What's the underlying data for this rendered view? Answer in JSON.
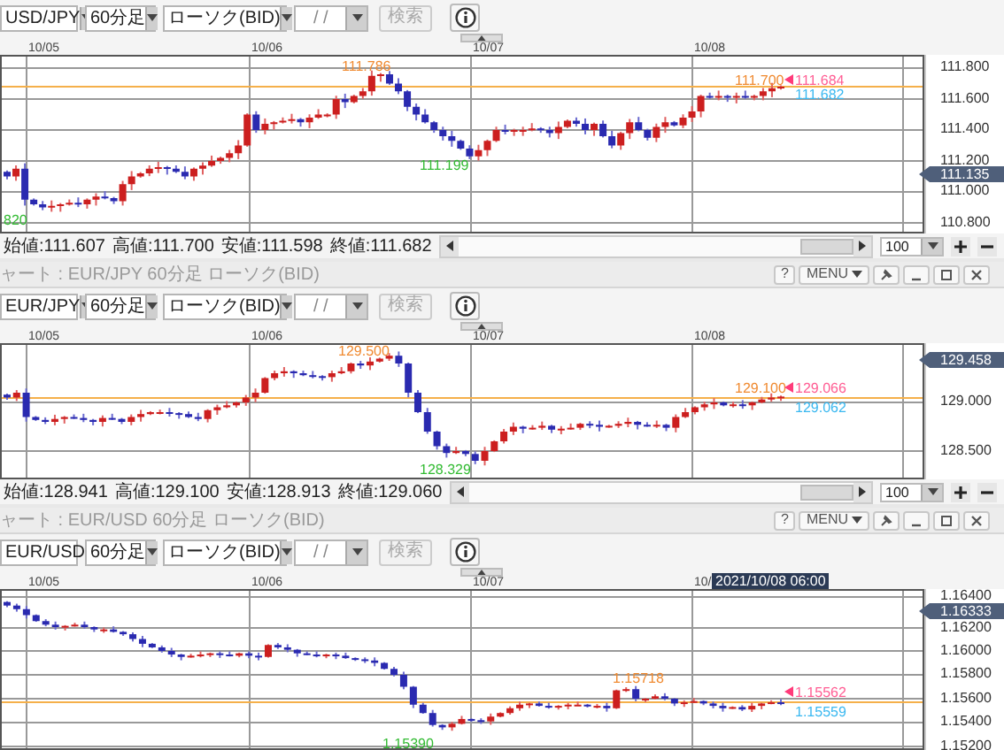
{
  "panels": [
    {
      "toolbar": {
        "pair": "USD/JPY",
        "timeframe": "60分足",
        "chart_type": "ローソク(BID)",
        "date": "/ /",
        "search": {
          "label": "検索",
          "disabled": true
        }
      },
      "dates": [
        "10/05",
        "10/06",
        "10/07",
        "10/08"
      ],
      "y_ticks": [
        "111.800",
        "111.600",
        "111.400",
        "111.200",
        "111.000",
        "110.800"
      ],
      "current_price": "111.135",
      "annotations": [
        {
          "kind": "high",
          "text": "111.786"
        },
        {
          "kind": "low",
          "text": "111.199"
        },
        {
          "kind": "low",
          "text": "820"
        },
        {
          "kind": "high",
          "text": "111.700"
        },
        {
          "kind": "ask",
          "text": "111.684"
        },
        {
          "kind": "bid",
          "text": "111.682"
        }
      ],
      "ohlc": [
        "始値:111.607",
        "高値:111.700",
        "安値:111.598",
        "終値:111.682"
      ],
      "zoom": "100"
    },
    {
      "title_bar": {
        "title": "ャート : EUR/JPY 60分足 ローソク(BID)",
        "help": "?",
        "menu": "MENU"
      },
      "toolbar": {
        "pair": "EUR/JPY",
        "timeframe": "60分足",
        "chart_type": "ローソク(BID)",
        "date": "/ /",
        "search": {
          "label": "検索",
          "disabled": true
        }
      },
      "dates": [
        "10/05",
        "10/06",
        "10/07",
        "10/08"
      ],
      "y_ticks": [
        "129.000",
        "128.500"
      ],
      "current_price": "129.458",
      "annotations": [
        {
          "kind": "high",
          "text": "129.500"
        },
        {
          "kind": "low",
          "text": "128.329"
        },
        {
          "kind": "high",
          "text": "129.100"
        },
        {
          "kind": "ask",
          "text": "129.066"
        },
        {
          "kind": "bid",
          "text": "129.062"
        }
      ],
      "ohlc": [
        "始値:128.941",
        "高値:129.100",
        "安値:128.913",
        "終値:129.060"
      ],
      "zoom": "100"
    },
    {
      "title_bar": {
        "title": "ャート : EUR/USD 60分足 ローソク(BID)",
        "help": "?",
        "menu": "MENU"
      },
      "toolbar": {
        "pair": "EUR/USD",
        "timeframe": "60分足",
        "chart_type": "ローソク(BID)",
        "date": "/ /",
        "search": {
          "label": "検索",
          "disabled": true
        }
      },
      "dates": [
        "10/05",
        "10/06",
        "10/07",
        "10/"
      ],
      "crosshair_time": "2021/10/08 06:00",
      "y_ticks": [
        "1.16400",
        "1.16200",
        "1.16000",
        "1.15800",
        "1.15600",
        "1.15400",
        "1.15200"
      ],
      "current_price": "1.16333",
      "annotations": [
        {
          "kind": "high",
          "text": "1.15718"
        },
        {
          "kind": "low",
          "text": "1.15390"
        },
        {
          "kind": "ask",
          "text": "1.15562"
        },
        {
          "kind": "bid",
          "text": "1.15559"
        }
      ]
    }
  ]
}
